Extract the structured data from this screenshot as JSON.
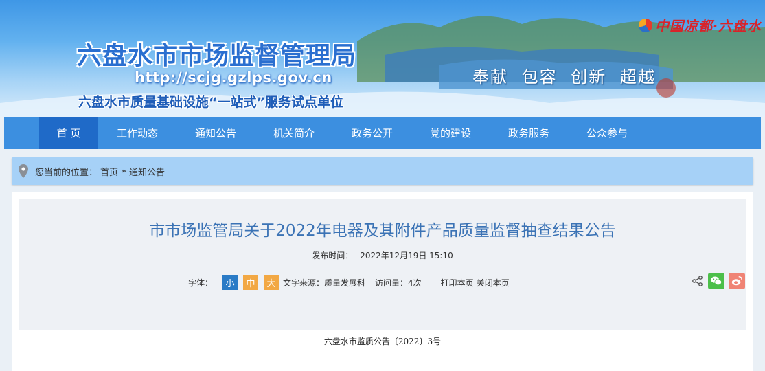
{
  "banner": {
    "title": "六盘水市市场监督管理局",
    "url": "http://scjg.gzlps.gov.cn",
    "slogan": "六盘水市质量基础设施“一站式”服务试点单位",
    "motto": "奉献 包容 创新 超越",
    "logo_text": "中国凉都·六盘水"
  },
  "nav": {
    "items": [
      {
        "label": "首 页"
      },
      {
        "label": "工作动态"
      },
      {
        "label": "通知公告"
      },
      {
        "label": "机关简介"
      },
      {
        "label": "政务公开"
      },
      {
        "label": "党的建设"
      },
      {
        "label": "政务服务"
      },
      {
        "label": "公众参与"
      }
    ]
  },
  "breadcrumb": {
    "prefix": "您当前的位置：",
    "home": "首页",
    "sep": "»",
    "current": "通知公告"
  },
  "article": {
    "title": "市市场监管局关于2022年电器及其附件产品质量监督抽查结果公告",
    "pub_label": "发布时间：",
    "pub_time": "2022年12月19日 15:10",
    "font_label": "字体：",
    "font_small": "小",
    "font_mid": "中",
    "font_big": "大",
    "source": "文字来源：质量发展科",
    "visits": "访问量：4次",
    "print": "打印本页",
    "close": "关闭本页",
    "doc_number": "六盘水市监质公告〔2022〕3号"
  },
  "icons": {
    "location": "map-pin-icon",
    "share": "share-icon",
    "wechat": "wechat-icon",
    "weibo": "weibo-icon"
  },
  "colors": {
    "nav_bg": "#3c8fe0",
    "nav_active": "#1f6ac8",
    "crumb_bg": "#a6d1f7",
    "title_color": "#3b73b5",
    "font_small_bg": "#2a7bc6",
    "font_mid_bg": "#f2a844"
  }
}
